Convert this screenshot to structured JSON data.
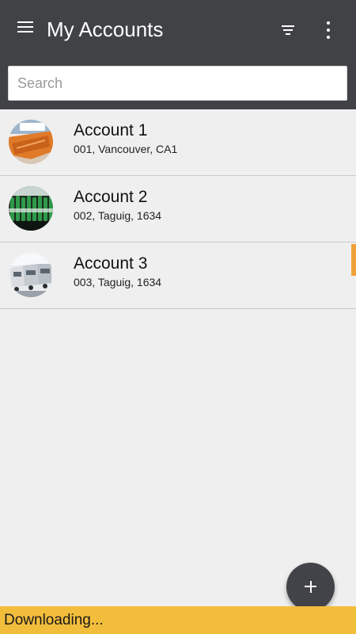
{
  "header": {
    "title": "My Accounts",
    "menu_icon": "hamburger-menu-icon",
    "filter_icon": "filter-icon",
    "more_icon": "more-vert-icon",
    "background_color": "#404246"
  },
  "search": {
    "placeholder": "Search",
    "value": ""
  },
  "accounts": [
    {
      "name": "Account 1",
      "detail": "001, Vancouver, CA1",
      "avatar": "excavator-bucket-photo",
      "selected": false
    },
    {
      "name": "Account 2",
      "detail": "002, Taguig, 1634",
      "avatar": "bottles-photo",
      "selected": false
    },
    {
      "name": "Account 3",
      "detail": "003, Taguig, 1634",
      "avatar": "trucks-photo",
      "selected": true
    }
  ],
  "fab": {
    "icon": "plus-icon"
  },
  "status": {
    "text": "Downloading...",
    "color": "#f3bd3c"
  },
  "accent_color": "#f0a23a"
}
